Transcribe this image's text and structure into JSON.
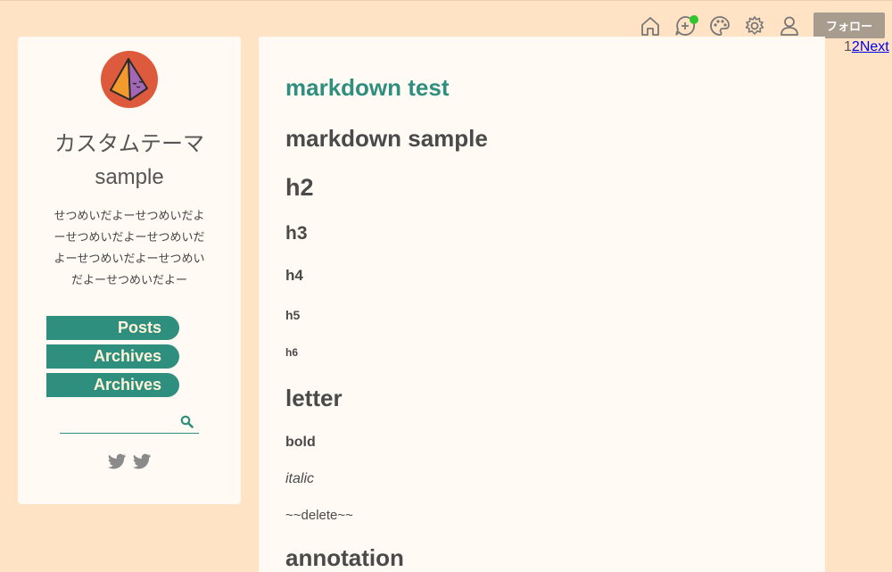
{
  "toolbar": {
    "icons": [
      "home-icon",
      "add-post-icon",
      "palette-icon",
      "gear-icon",
      "user-icon"
    ],
    "notification_color": "#2fc52f",
    "follow_label": "フォロー"
  },
  "pager": {
    "current": "1",
    "page2": "2",
    "next": "Next"
  },
  "sidebar": {
    "blog_title_line1": "カスタムテーマ",
    "blog_title_line2": "sample",
    "description": "せつめいだよーせつめいだよーせつめいだよーせつめいだよーせつめいだよーせつめいだよーせつめいだよー",
    "nav": [
      {
        "label": "Posts"
      },
      {
        "label": "Archives"
      },
      {
        "label": "Archives"
      }
    ],
    "search_placeholder": "",
    "socials": [
      "twitter-icon",
      "twitter-icon"
    ],
    "accent_color": "#2f8f7e"
  },
  "article": {
    "title": "markdown test",
    "h1": "markdown sample",
    "h2": "h2",
    "h3": "h3",
    "h4": "h4",
    "h5": "h5",
    "h6": "h6",
    "letter_heading": "letter",
    "bold": "bold",
    "italic": "italic",
    "delete": "~~delete~~",
    "annotation_heading": "annotation"
  }
}
